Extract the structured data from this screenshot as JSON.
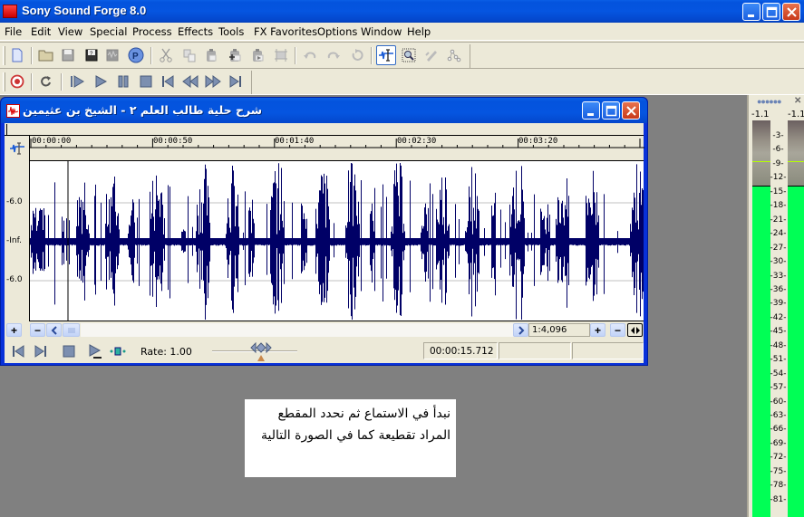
{
  "app": {
    "title": "Sony Sound Forge 8.0",
    "window_controls": [
      "minimize",
      "maximize",
      "close"
    ]
  },
  "menubar": {
    "items": [
      "File",
      "Edit",
      "View",
      "Special",
      "Process",
      "Effects",
      "Tools",
      "FX Favorites",
      "Options",
      "Window",
      "Help"
    ]
  },
  "toolbar_standard": {
    "buttons": [
      {
        "icon": "new-file-icon",
        "enabled": true
      },
      {
        "icon": "open-folder-icon",
        "enabled": true
      },
      {
        "icon": "save-icon",
        "enabled": false
      },
      {
        "icon": "save-as-icon",
        "enabled": true
      },
      {
        "icon": "render-as-icon",
        "enabled": false
      },
      {
        "icon": "publish-icon",
        "enabled": true
      },
      {
        "icon": "cut-icon",
        "enabled": false
      },
      {
        "icon": "copy-icon",
        "enabled": false
      },
      {
        "icon": "paste-icon",
        "enabled": false
      },
      {
        "icon": "mix-paste-icon",
        "enabled": false
      },
      {
        "icon": "crossfade-paste-icon",
        "enabled": false
      },
      {
        "icon": "trim-crop-icon",
        "enabled": false
      },
      {
        "icon": "undo-icon",
        "enabled": false
      },
      {
        "icon": "redo-icon",
        "enabled": false
      },
      {
        "icon": "repeat-icon",
        "enabled": false
      },
      {
        "icon": "edit-tool-icon",
        "enabled": true,
        "active": true
      },
      {
        "icon": "magnify-tool-icon",
        "enabled": true
      },
      {
        "icon": "pencil-tool-icon",
        "enabled": false
      },
      {
        "icon": "envelope-tool-icon",
        "enabled": false
      }
    ]
  },
  "toolbar_transport": {
    "buttons": [
      "record",
      "loop-playback",
      "play-all",
      "play",
      "pause",
      "stop",
      "go-to-start",
      "rewind",
      "forward",
      "go-to-end"
    ]
  },
  "data_window": {
    "title": "شرح حلية طالب العلم ٢ - الشيخ بن  عثيمين",
    "ruler_labels": [
      "00:00:00",
      "00:00:50",
      "00:01:40",
      "00:02:30",
      "00:03:20"
    ],
    "db_labels": [
      "-6.0",
      "-Inf.",
      "-6.0"
    ],
    "zoom_ratio": "1:4,096",
    "rate_label": "Rate: 1.00",
    "cursor_position": "00:00:15.712",
    "status_fields": [
      "",
      ""
    ],
    "waveform_color": "#000066"
  },
  "meters": {
    "peak_left": "-1.1",
    "peak_right": "-1.1",
    "scale": [
      "3",
      "6",
      "9",
      "12",
      "15",
      "18",
      "21",
      "24",
      "27",
      "30",
      "33",
      "36",
      "39",
      "42",
      "45",
      "48",
      "51",
      "54",
      "57",
      "60",
      "63",
      "66",
      "69",
      "72",
      "75",
      "78",
      "81"
    ],
    "level_color": "#00ff55"
  },
  "note": {
    "line1": "نبدأ في الاستماع ثم نحدد المقطع",
    "line2": "المراد تقطيعة كما في الصورة التالية"
  }
}
